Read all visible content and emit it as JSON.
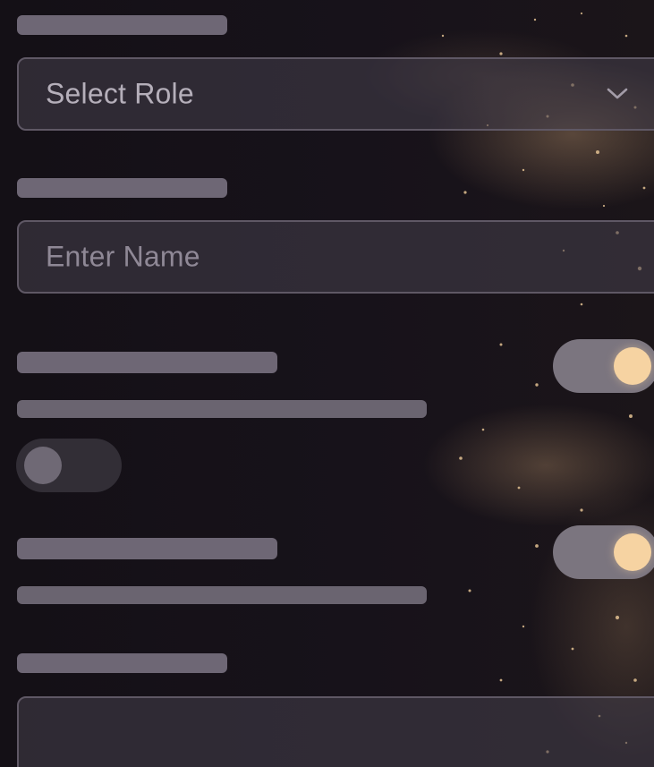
{
  "role_select": {
    "selected_text": "Select Role"
  },
  "name_input": {
    "value": "",
    "placeholder": "Enter Name"
  },
  "toggles": [
    {
      "state": "on"
    },
    {
      "state": "off"
    },
    {
      "state": "on"
    }
  ],
  "colors": {
    "background": "#141016",
    "field_background": "#3a3540",
    "field_border": "#5f5865",
    "placeholder_bar": "#6e6775",
    "toggle_on_knob": "#f6d3a2",
    "toggle_on_track": "#7b757f",
    "toggle_off_track": "#322e36"
  },
  "icons": {
    "select_chevron": "chevron-down-icon"
  }
}
